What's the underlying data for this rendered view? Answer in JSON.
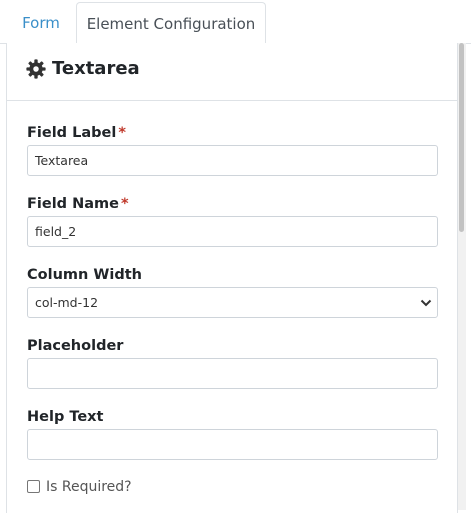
{
  "tabs": [
    {
      "label": "Form"
    },
    {
      "label": "Element Configuration"
    }
  ],
  "panel": {
    "icon": "gear-icon",
    "title": "Textarea"
  },
  "fields": {
    "field_label": {
      "label": "Field Label",
      "required_mark": "*",
      "value": "Textarea"
    },
    "field_name": {
      "label": "Field Name",
      "required_mark": "*",
      "value": "field_2"
    },
    "column_width": {
      "label": "Column Width",
      "selected": "col-md-12"
    },
    "placeholder": {
      "label": "Placeholder",
      "value": ""
    },
    "help_text": {
      "label": "Help Text",
      "value": ""
    }
  },
  "is_required": {
    "label": "Is Required?",
    "checked": false
  },
  "colors": {
    "active_link": "#3a8fc9",
    "required": "#c0392b",
    "border": "#dee2e6"
  }
}
